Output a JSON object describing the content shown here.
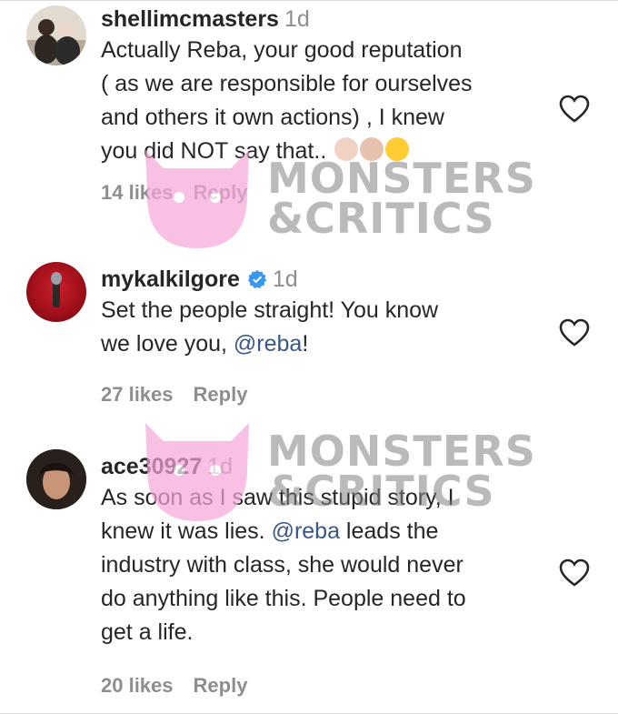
{
  "comments": [
    {
      "username": "shellimcmasters",
      "time": "1d",
      "text_lines": [
        "Actually Reba, your good reputation",
        "( as we are responsible for ourselves",
        "and others it own actions) , I knew",
        "you did NOT say that.."
      ],
      "likes": "14 likes",
      "reply": "Reply",
      "emoji": [
        "woman-raising-hand-emoji",
        "woman-raising-hand-emoji",
        "grimacing-face-emoji"
      ]
    },
    {
      "username": "mykalkilgore",
      "verified": true,
      "time": "1d",
      "text_before": "Set the people straight! You know",
      "text_line2_before": "we love you, ",
      "mention": "@reba",
      "text_after": "!",
      "likes": "27 likes",
      "reply": "Reply"
    },
    {
      "username": "ace30927",
      "time": "1d",
      "line1": "As soon as I saw this stupid story, I",
      "line2_before": "knew it was lies. ",
      "mention": "@reba",
      "line2_after": " leads the",
      "line3": "industry with class, she would never",
      "line4": "do anything like this. People need to",
      "line5": "get a life.",
      "likes": "20 likes",
      "reply": "Reply"
    }
  ],
  "watermark": {
    "line1": "MONSTERS",
    "line2": "&CRITICS",
    "mascot_color": "#f6a8d8",
    "text_color": "#8a8a8a"
  },
  "colors": {
    "username": "#262626",
    "meta": "#8e8e8e",
    "mention": "#3b5786",
    "verified": "#3897f0"
  },
  "icons": {
    "like": "heart-outline-icon",
    "verified": "verified-badge-icon"
  }
}
